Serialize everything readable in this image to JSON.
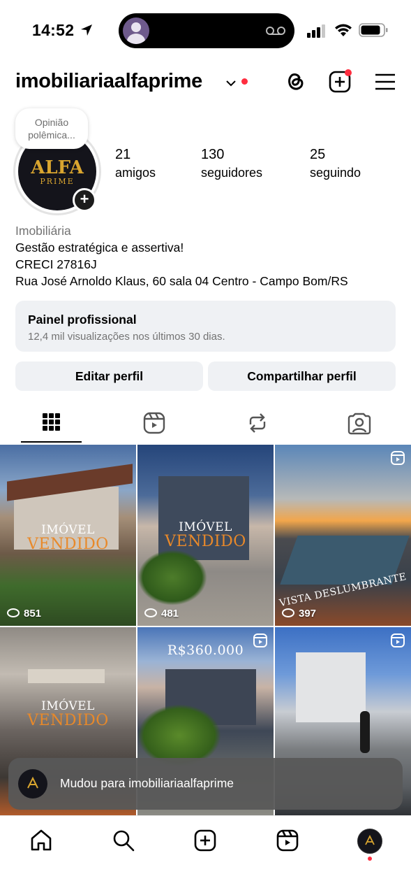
{
  "status_bar": {
    "time": "14:52",
    "icons": [
      "location-arrow-icon",
      "voicemail-icon",
      "signal-icon",
      "wifi-icon",
      "battery-icon"
    ]
  },
  "header": {
    "username": "imobiliariaalfaprime",
    "icons": [
      "chevron-down-icon",
      "threads-icon",
      "create-icon",
      "menu-icon"
    ],
    "notification_color": "#ff2d3f"
  },
  "profile": {
    "note": "Opinião polêmica...",
    "logo_top": "ALFA",
    "logo_bottom": "PRIME",
    "stats": [
      {
        "value": "21",
        "label": "amigos"
      },
      {
        "value": "130",
        "label": "seguidores"
      },
      {
        "value": "25",
        "label": "seguindo"
      }
    ],
    "category": "Imobiliária",
    "bio_lines": [
      "Gestão estratégica e assertiva!",
      "CRECI 27816J",
      "Rua José Arnoldo Klaus, 60 sala 04 Centro - Campo Bom/RS"
    ]
  },
  "pro_panel": {
    "title": "Painel profissional",
    "subtitle": "12,4 mil visualizações nos últimos 30 dias."
  },
  "buttons": {
    "edit": "Editar perfil",
    "share": "Compartilhar perfil"
  },
  "tabs": [
    "grid-icon",
    "reels-icon",
    "reposts-icon",
    "tagged-icon"
  ],
  "posts": [
    {
      "views": "851",
      "overlay_top": "IMÓVEL",
      "overlay_bottom": "VENDIDO",
      "reel": false
    },
    {
      "views": "481",
      "overlay_top": "IMÓVEL",
      "overlay_bottom": "VENDIDO",
      "reel": false
    },
    {
      "views": "397",
      "overlay_top": "VISTA DESLUMBRANTE",
      "overlay_bottom": "",
      "reel": true
    },
    {
      "views": "",
      "overlay_top": "IMÓVEL",
      "overlay_bottom": "VENDIDO",
      "reel": false
    },
    {
      "views": "",
      "overlay_top": "R$360.000",
      "overlay_bottom": "",
      "reel": true
    },
    {
      "views": "",
      "overlay_top": "",
      "overlay_bottom": "",
      "reel": true
    }
  ],
  "toast": {
    "text": "Mudou para imobiliariaalfaprime"
  },
  "bottom_nav": [
    "home-icon",
    "search-icon",
    "create-icon",
    "reels-icon",
    "profile-avatar"
  ]
}
